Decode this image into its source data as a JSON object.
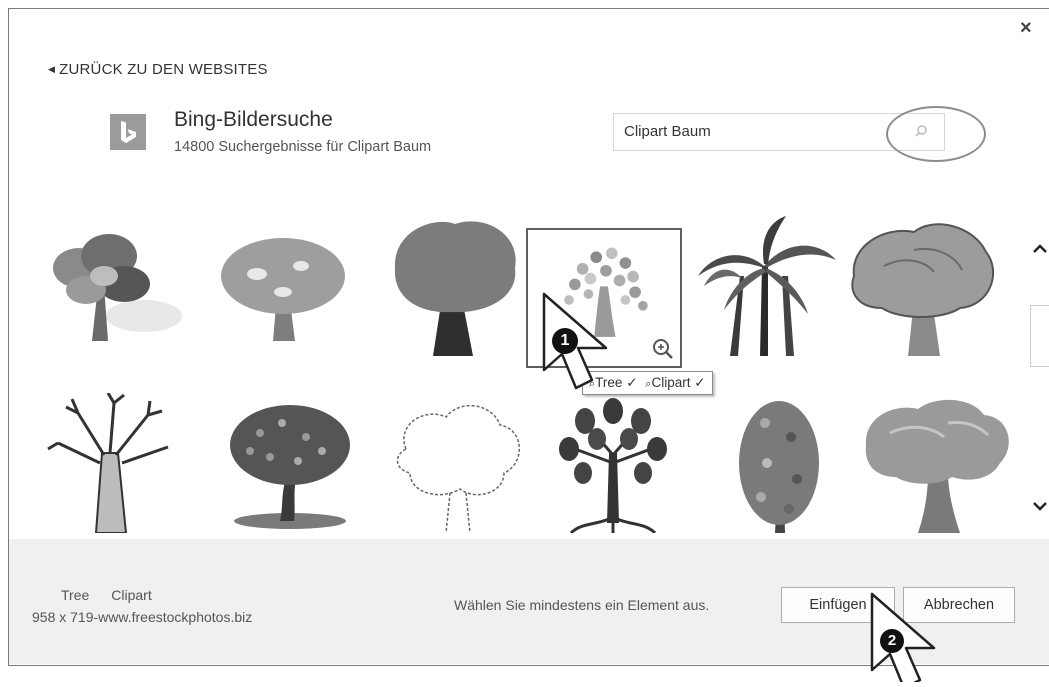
{
  "dialog": {
    "close_glyph": "×"
  },
  "nav": {
    "back_label": "ZURÜCK ZU DEN WEBSITES",
    "back_icon": "triangle-left-icon"
  },
  "provider": {
    "name": "Bing-Bildersuche",
    "results_text": "14800 Suchergebnisse für Clipart Baum",
    "logo_color": "#9b9b9b"
  },
  "search": {
    "value": "Clipart Baum",
    "icon": "search-icon"
  },
  "results": {
    "items": [
      {
        "kind": "tree-bushy"
      },
      {
        "kind": "tree-spreading"
      },
      {
        "kind": "tree-lollipop"
      },
      {
        "kind": "tree-leafy",
        "selected": true
      },
      {
        "kind": "palm-trees"
      },
      {
        "kind": "tree-oak"
      },
      {
        "kind": "tree-bare"
      },
      {
        "kind": "tree-apple"
      },
      {
        "kind": "tree-outline"
      },
      {
        "kind": "tree-roots"
      },
      {
        "kind": "tree-autumn"
      },
      {
        "kind": "tree-cartoon"
      }
    ],
    "tooltip": {
      "tag1": "Tree",
      "tag2": "Clipart",
      "check": "✓"
    }
  },
  "footer": {
    "tag1": "Tree",
    "tag2": "Clipart",
    "info": "958 x 719-www.freestockphotos.biz",
    "hint": "Wählen Sie mindestens ein Element aus.",
    "insert_label": "Einfügen",
    "cancel_label": "Abbrechen"
  },
  "annotations": {
    "step1": "1",
    "step2": "2"
  },
  "colors": {
    "footer_bg": "#f0f0f0",
    "border": "#adadad",
    "accent_circle": "#8c8c8c"
  }
}
